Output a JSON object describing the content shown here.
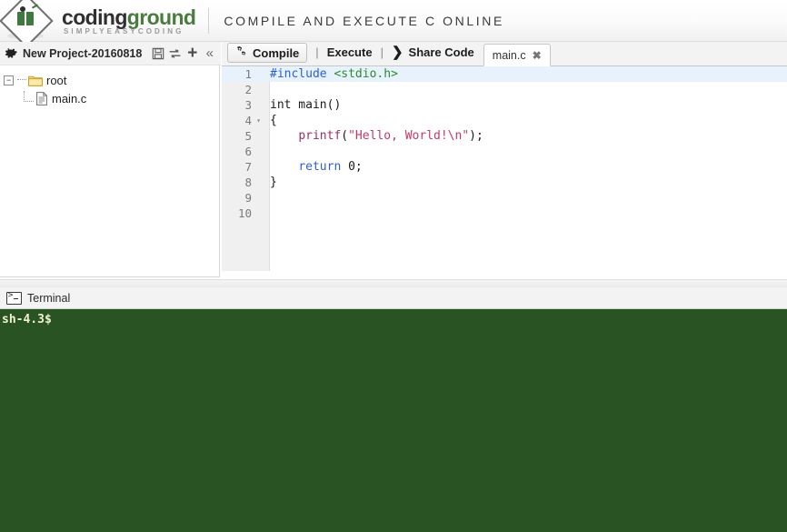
{
  "header": {
    "logo_word_1": "coding",
    "logo_word_2": "ground",
    "logo_tagline": "SIMPLYEASYCODING",
    "title": "COMPILE AND EXECUTE C ONLINE",
    "logo_icon": "diamond-book-logo-icon"
  },
  "project_bar": {
    "gear_icon": "gear-icon",
    "project_name": "New Project-20160818",
    "save_icon": "save-floppy-icon",
    "refresh_icon": "refresh-sync-icon",
    "add_icon": "plus-icon",
    "collapse_icon": "collapse-left-icon",
    "save_glyph": "💾",
    "refresh_glyph": "↻",
    "add_glyph": "+",
    "collapse_glyph": "«"
  },
  "file_tree": {
    "root": {
      "toggle": "−",
      "icon": "folder-icon",
      "label": "root"
    },
    "children": [
      {
        "icon": "file-icon",
        "label": "main.c"
      }
    ]
  },
  "toolbar": {
    "compile_label": "Compile",
    "compile_icon": "gears-icon",
    "separator": "|",
    "execute_label": "Execute",
    "share_label": "Share Code",
    "share_icon": "arrow-right-icon",
    "share_glyph": "❯"
  },
  "tabs": [
    {
      "label": "main.c",
      "close_glyph": "✖",
      "active": true
    }
  ],
  "editor": {
    "active_line": 1,
    "total_lines": 10,
    "fold_marker_line": 4,
    "fold_glyph": "▾",
    "lines": [
      {
        "n": "1",
        "tokens": [
          {
            "t": "#include ",
            "c": "k-pre"
          },
          {
            "t": "<stdio.h>",
            "c": "k-inc"
          }
        ]
      },
      {
        "n": "2",
        "tokens": []
      },
      {
        "n": "3",
        "tokens": [
          {
            "t": "int main()",
            "c": "k-type"
          }
        ]
      },
      {
        "n": "4",
        "tokens": [
          {
            "t": "{",
            "c": "k-punc"
          }
        ]
      },
      {
        "n": "5",
        "tokens": [
          {
            "t": "    ",
            "c": "k-punc"
          },
          {
            "t": "printf",
            "c": "k-fn"
          },
          {
            "t": "(",
            "c": "k-punc"
          },
          {
            "t": "\"Hello, World!\\n\"",
            "c": "k-str"
          },
          {
            "t": ");",
            "c": "k-punc"
          }
        ]
      },
      {
        "n": "6",
        "tokens": []
      },
      {
        "n": "7",
        "tokens": [
          {
            "t": "    ",
            "c": "k-punc"
          },
          {
            "t": "return",
            "c": "k-kw"
          },
          {
            "t": " 0;",
            "c": "k-num"
          }
        ]
      },
      {
        "n": "8",
        "tokens": [
          {
            "t": "}",
            "c": "k-punc"
          }
        ]
      },
      {
        "n": "9",
        "tokens": []
      },
      {
        "n": "10",
        "tokens": []
      }
    ]
  },
  "terminal": {
    "icon": "console-icon",
    "title": "Terminal",
    "prompt": "sh-4.3$",
    "lines": [
      "sh-4.3$"
    ],
    "background_color": "#2a5324",
    "text_color": "#f2f2c8"
  },
  "colors": {
    "accent_green": "#4a7b3f",
    "terminal_green": "#2a5324",
    "active_line": "#e8f2fd",
    "preprocessor": "#2b5fd9",
    "include_path": "#2e8b2e",
    "string": "#c2386b",
    "function": "#9b3066"
  }
}
